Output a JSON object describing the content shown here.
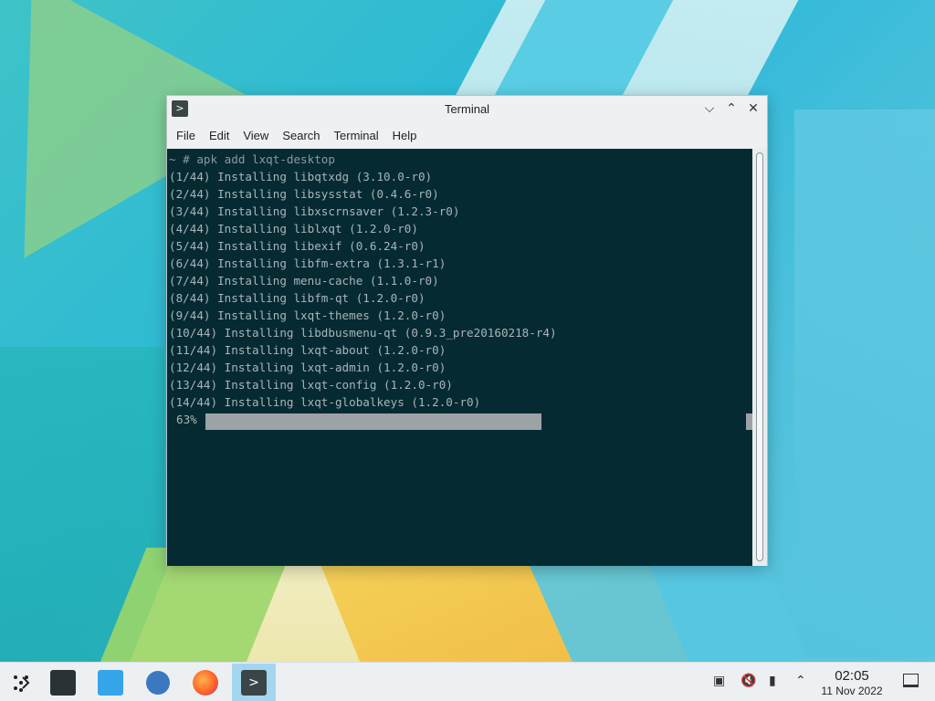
{
  "window": {
    "title": "Terminal",
    "app_icon": "terminal-icon",
    "controls": {
      "minimize": "⌵",
      "maximize": "⌃",
      "close": "✕"
    }
  },
  "menubar": {
    "items": [
      "File",
      "Edit",
      "View",
      "Search",
      "Terminal",
      "Help"
    ]
  },
  "terminal": {
    "lines": [
      "~ # apk add lxqt-desktop",
      "(1/44) Installing libqtxdg (3.10.0-r0)",
      "(2/44) Installing libsysstat (0.4.6-r0)",
      "(3/44) Installing libxscrnsaver (1.2.3-r0)",
      "(4/44) Installing liblxqt (1.2.0-r0)",
      "(5/44) Installing libexif (0.6.24-r0)",
      "(6/44) Installing libfm-extra (1.3.1-r1)",
      "(7/44) Installing menu-cache (1.1.0-r0)",
      "(8/44) Installing libfm-qt (1.2.0-r0)",
      "(9/44) Installing lxqt-themes (1.2.0-r0)",
      "(10/44) Installing libdbusmenu-qt (0.9.3_pre20160218-r4)",
      "(11/44) Installing lxqt-about (1.2.0-r0)",
      "(12/44) Installing lxqt-admin (1.2.0-r0)",
      "(13/44) Installing lxqt-config (1.2.0-r0)",
      "(14/44) Installing lxqt-globalkeys (1.2.0-r0)"
    ],
    "progress_text": "63%",
    "progress_value": 0.63
  },
  "taskbar": {
    "launcher_icon": "app-launcher-icon",
    "items": [
      {
        "name": "system-settings-icon"
      },
      {
        "name": "software-store-icon"
      },
      {
        "name": "search-icon"
      },
      {
        "name": "firefox-icon"
      },
      {
        "name": "terminal-icon",
        "active": true
      }
    ],
    "terminal_glyph": ">"
  },
  "tray": {
    "icons": [
      "display-icon",
      "volume-muted-icon",
      "usb-icon",
      "expand-tray-icon"
    ],
    "glyphs": [
      "▣",
      "🔇",
      "▮",
      "⌃"
    ]
  },
  "clock": {
    "time": "02:05",
    "date": "11 Nov 2022"
  }
}
